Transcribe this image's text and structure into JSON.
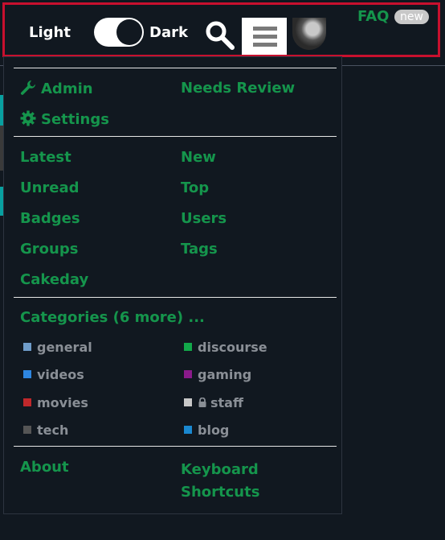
{
  "header": {
    "light_label": "Light",
    "dark_label": "Dark",
    "faq_label": "FAQ",
    "faq_badge": "new"
  },
  "menu": {
    "admin_links": [
      {
        "label": "Admin",
        "icon": "wrench-icon"
      },
      {
        "label": "Needs Review"
      },
      {
        "label": "Settings",
        "icon": "gear-icon"
      }
    ],
    "nav_links": [
      "Latest",
      "New",
      "Unread",
      "Top",
      "Badges",
      "Users",
      "Groups",
      "Tags",
      "Cakeday"
    ],
    "categories_heading": "Categories (6 more) ...",
    "categories": [
      {
        "name": "general",
        "color": "#6f9cc9"
      },
      {
        "name": "discourse",
        "color": "#12a84a"
      },
      {
        "name": "videos",
        "color": "#2e86e0"
      },
      {
        "name": "gaming",
        "color": "#8a1a8a"
      },
      {
        "name": "movies",
        "color": "#c0282b"
      },
      {
        "name": "staff",
        "color": "#c8c8c8",
        "locked": true
      },
      {
        "name": "tech",
        "color": "#555555"
      },
      {
        "name": "blog",
        "color": "#1a88d0"
      }
    ],
    "footer_links": [
      "About",
      "Keyboard Shortcuts"
    ]
  },
  "colors": {
    "accent": "#15954c",
    "background": "#111820",
    "highlight_border": "#c8102e"
  }
}
